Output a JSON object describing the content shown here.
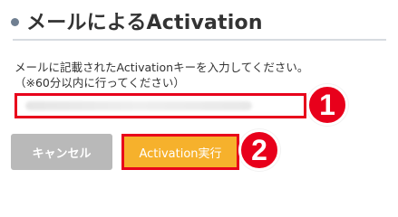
{
  "header": {
    "title": "メールによるActivation"
  },
  "instructions": {
    "line1": "メールに記載されたActivationキーを入力してください。",
    "line2": "（※60分以内に行ってください）"
  },
  "activation_input": {
    "value": "",
    "placeholder": ""
  },
  "buttons": {
    "cancel_label": "キャンセル",
    "activate_label": "Activation実行"
  },
  "badges": {
    "step1": "1",
    "step2": "2"
  },
  "colors": {
    "highlight_red": "#e8001b",
    "activate_button": "#f6b12c",
    "cancel_button": "#b9b9b9",
    "title_dot": "#6f7f91"
  }
}
